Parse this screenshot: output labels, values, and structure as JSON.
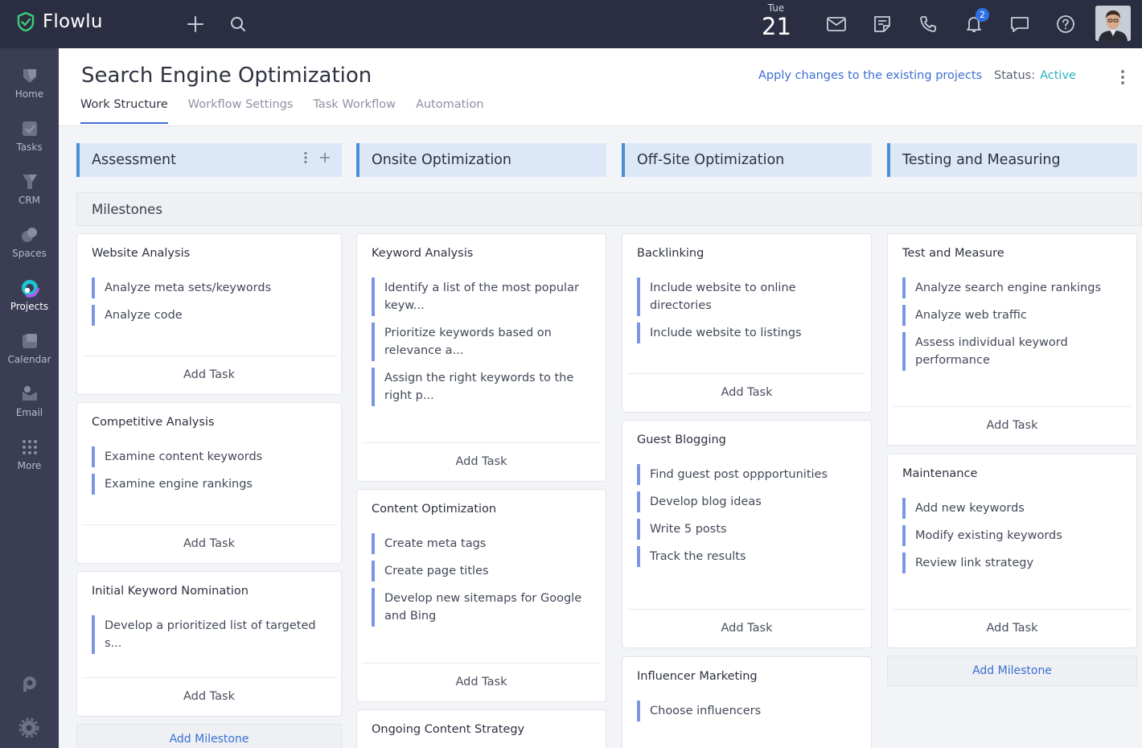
{
  "app": {
    "name": "Flowlu"
  },
  "topbar": {
    "date_dow": "Tue",
    "date_day": "21",
    "notification_count": "2"
  },
  "sidebar": {
    "items": [
      {
        "label": "Home",
        "icon": "home-icon"
      },
      {
        "label": "Tasks",
        "icon": "tasks-icon"
      },
      {
        "label": "CRM",
        "icon": "crm-icon"
      },
      {
        "label": "Spaces",
        "icon": "spaces-icon"
      },
      {
        "label": "Projects",
        "icon": "projects-icon"
      },
      {
        "label": "Calendar",
        "icon": "calendar-icon"
      },
      {
        "label": "Email",
        "icon": "email-icon"
      },
      {
        "label": "More",
        "icon": "more-icon"
      }
    ]
  },
  "header": {
    "title": "Search Engine Optimization",
    "tabs": [
      "Work Structure",
      "Workflow Settings",
      "Task Workflow",
      "Automation"
    ],
    "apply_link": "Apply changes to the existing projects",
    "status_label": "Status:",
    "status_value": "Active"
  },
  "board": {
    "milestones_label": "Milestones",
    "add_task_label": "Add Task",
    "add_milestone_label": "Add Milestone",
    "columns": [
      {
        "title": "Assessment",
        "milestones": [
          {
            "title": "Website Analysis",
            "tasks": [
              "Analyze meta sets/keywords",
              "Analyze code"
            ]
          },
          {
            "title": "Competitive Analysis",
            "tasks": [
              "Examine content keywords",
              "Examine engine rankings"
            ]
          },
          {
            "title": "Initial Keyword Nomination",
            "tasks": [
              "Develop a prioritized list of targeted s..."
            ]
          }
        ]
      },
      {
        "title": "Onsite Optimization",
        "milestones": [
          {
            "title": "Keyword Analysis",
            "tasks": [
              "Identify a list of the most popular keyw...",
              "Prioritize keywords based on relevance a...",
              "Assign the right keywords to the right p..."
            ]
          },
          {
            "title": "Content Optimization",
            "tasks": [
              "Create meta tags",
              "Create page titles",
              "Develop new sitemaps for Google and Bing"
            ]
          },
          {
            "title": "Ongoing Content Strategy",
            "tasks": []
          }
        ]
      },
      {
        "title": "Off-Site Optimization",
        "milestones": [
          {
            "title": "Backlinking",
            "tasks": [
              "Include website to online directories",
              "Include website to listings"
            ]
          },
          {
            "title": "Guest Blogging",
            "tasks": [
              "Find guest post oppportunities",
              "Develop blog ideas",
              "Write 5 posts",
              "Track the results"
            ]
          },
          {
            "title": "Influencer Marketing",
            "tasks": [
              "Choose influencers"
            ]
          }
        ]
      },
      {
        "title": "Testing and Measuring",
        "milestones": [
          {
            "title": "Test and Measure",
            "tasks": [
              "Analyze search engine rankings",
              "Analyze web traffic",
              "Assess individual keyword performance"
            ]
          },
          {
            "title": "Maintenance",
            "tasks": [
              "Add new keywords",
              "Modify existing keywords",
              "Review link strategy"
            ]
          }
        ]
      }
    ]
  },
  "colors": {
    "topbar": "#2b2e42",
    "sidebar": "#3a3d53",
    "accent": "#3b6fd2",
    "status_active": "#2bb5b8",
    "task_bar": "#7c96e4"
  }
}
